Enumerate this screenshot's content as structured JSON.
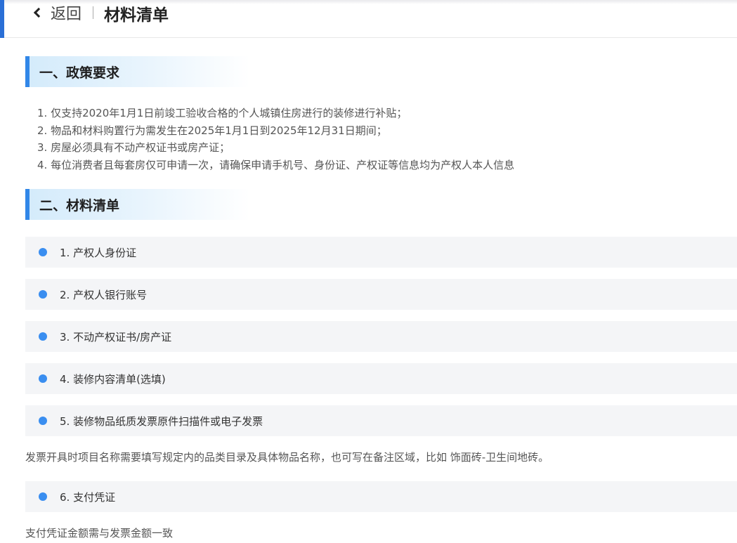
{
  "header": {
    "back_label": "返回",
    "title": "材料清单"
  },
  "sections": {
    "policy": {
      "heading": "一、政策要求",
      "items": [
        "1. 仅支持2020年1月1日前竣工验收合格的个人城镇住房进行的装修进行补贴；",
        "2. 物品和材料购置行为需发生在2025年1月1日到2025年12月31日期间；",
        "3. 房屋必须具有不动产权证书或房产证；",
        "4. 每位消费者且每套房仅可申请一次，请确保申请手机号、身份证、产权证等信息均为产权人本人信息"
      ]
    },
    "materials": {
      "heading": "二、材料清单",
      "items": [
        "1. 产权人身份证",
        "2. 产权人银行账号",
        "3. 不动产权证书/房产证",
        "4. 装修内容清单(选填)",
        "5. 装修物品纸质发票原件扫描件或电子发票",
        "6. 支付凭证"
      ],
      "invoice_note": "发票开具时项目名称需要填写规定内的品类目录及具体物品名称，也可写在备注区域，比如 饰面砖-卫生间地砖。",
      "payment_note": "支付凭证金额需与发票金额一致"
    }
  },
  "colors": {
    "accent": "#3187e8",
    "bullet": "#3a8ef0",
    "item_bg": "#f4f5f7"
  }
}
